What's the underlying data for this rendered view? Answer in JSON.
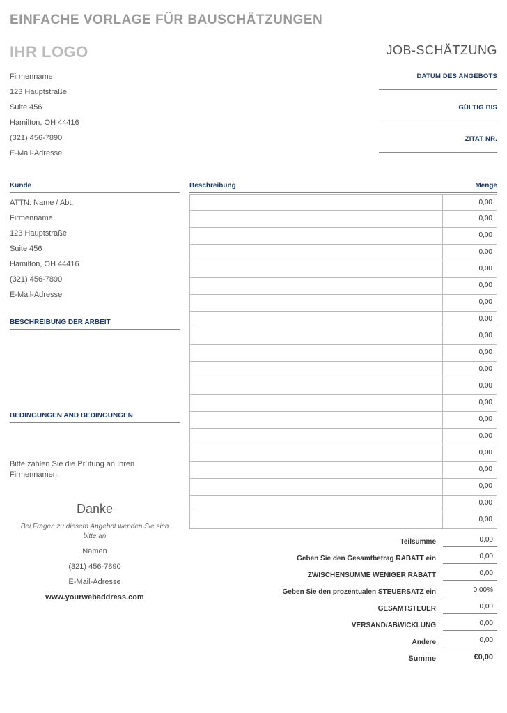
{
  "title": "EINFACHE VORLAGE FÜR BAUSCHÄTZUNGEN",
  "logo": "IHR LOGO",
  "job_est": "JOB-SCHÄTZUNG",
  "company": {
    "name": "Firmenname",
    "street": "123 Hauptstraße",
    "suite": "Suite 456",
    "city": "Hamilton, OH 44416",
    "phone": "(321) 456-7890",
    "email": "E-Mail-Adresse"
  },
  "meta": {
    "date_label": "DATUM DES ANGEBOTS",
    "valid_label": "GÜLTIG BIS",
    "quote_label": "ZITAT NR."
  },
  "customer": {
    "heading": "Kunde",
    "attn": "ATTN: Name / Abt.",
    "name": "Firmenname",
    "street": "123 Hauptstraße",
    "suite": "Suite 456",
    "city": "Hamilton, OH 44416",
    "phone": "(321) 456-7890",
    "email": "E-Mail-Adresse"
  },
  "work": {
    "heading": "BESCHREIBUNG DER ARBEIT"
  },
  "terms": {
    "heading": "BEDINGUNGEN AND BEDINGUNGEN",
    "note": "Bitte zahlen Sie die Prüfung an Ihren Firmennamen."
  },
  "thanks": {
    "big": "Danke",
    "small": "Bei Fragen zu diesem Angebot wenden Sie sich bitte an",
    "name": "Namen",
    "phone": "(321) 456-7890",
    "email": "E-Mail-Adresse",
    "web": "www.yourwebaddress.com"
  },
  "grid": {
    "desc_head": "Beschreibung",
    "amt_head": "Menge",
    "rows": [
      {
        "amt": "0,00"
      },
      {
        "amt": "0,00"
      },
      {
        "amt": "0,00"
      },
      {
        "amt": "0,00"
      },
      {
        "amt": "0,00"
      },
      {
        "amt": "0,00"
      },
      {
        "amt": "0,00"
      },
      {
        "amt": "0,00"
      },
      {
        "amt": "0,00"
      },
      {
        "amt": "0,00"
      },
      {
        "amt": "0,00"
      },
      {
        "amt": "0,00"
      },
      {
        "amt": "0,00"
      },
      {
        "amt": "0,00"
      },
      {
        "amt": "0,00"
      },
      {
        "amt": "0,00"
      },
      {
        "amt": "0,00"
      },
      {
        "amt": "0,00"
      },
      {
        "amt": "0,00"
      },
      {
        "amt": "0,00"
      }
    ]
  },
  "totals": [
    {
      "label": "Teilsumme",
      "val": "0,00"
    },
    {
      "label": "Geben Sie den Gesamtbetrag  RABATT ein",
      "val": "0,00"
    },
    {
      "label": "ZWISCHENSUMME WENIGER RABATT",
      "val": "0,00"
    },
    {
      "label": "Geben Sie den prozentualen  STEUERSATZ ein",
      "val": "0,00%"
    },
    {
      "label": "GESAMTSTEUER",
      "val": "0,00"
    },
    {
      "label": "VERSAND/ABWICKLUNG",
      "val": "0,00"
    },
    {
      "label": "Andere",
      "val": "0,00"
    }
  ],
  "final": {
    "label": "Summe",
    "val": "€0,00"
  }
}
